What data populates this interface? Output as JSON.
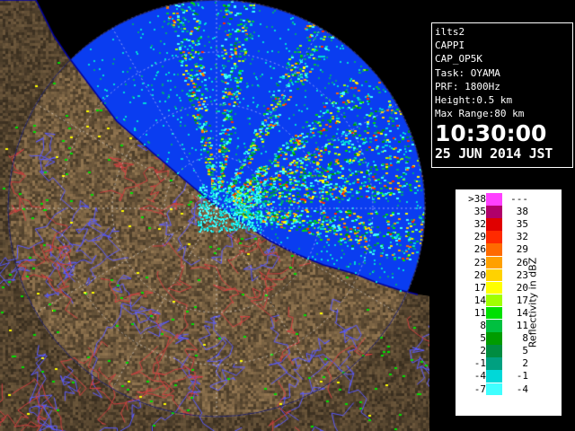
{
  "info_panel": {
    "lines": [
      "ilts2",
      "CAPPI",
      "CAP_OP5K",
      "Task: OYAMA",
      "PRF: 1800Hz",
      "Height:0.5 km",
      "Max Range:80 km"
    ],
    "time": "10:30:00",
    "date": "25 JUN 2014 JST"
  },
  "legend": {
    "title": "Reflectivity in dBZ",
    "rows": [
      {
        "low": ">38",
        "high": "---",
        "color": "#ff40ff"
      },
      {
        "low": "35",
        "high": "38",
        "color": "#b0006a"
      },
      {
        "low": "32",
        "high": "35",
        "color": "#e00000"
      },
      {
        "low": "29",
        "high": "32",
        "color": "#ff2a00"
      },
      {
        "low": "26",
        "high": "29",
        "color": "#ff6a00"
      },
      {
        "low": "23",
        "high": "26",
        "color": "#ffa000"
      },
      {
        "low": "20",
        "high": "23",
        "color": "#ffd200"
      },
      {
        "low": "17",
        "high": "20",
        "color": "#ffff00"
      },
      {
        "low": "14",
        "high": "17",
        "color": "#a0ff00"
      },
      {
        "low": "11",
        "high": "14",
        "color": "#00e000"
      },
      {
        "low": "8",
        "high": "11",
        "color": "#00c040"
      },
      {
        "low": "5",
        "high": "8",
        "color": "#009c00"
      },
      {
        "low": "2",
        "high": "5",
        "color": "#008c40"
      },
      {
        "low": "-1",
        "high": "2",
        "color": "#00a080"
      },
      {
        "low": "-4",
        "high": "-1",
        "color": "#00d8d8"
      },
      {
        "low": "-7",
        "high": "-4",
        "color": "#40ffff"
      }
    ]
  },
  "map": {
    "sea_color": "#0a3df0",
    "land_color": "#7a6448",
    "coast_color": "#0000a0"
  }
}
